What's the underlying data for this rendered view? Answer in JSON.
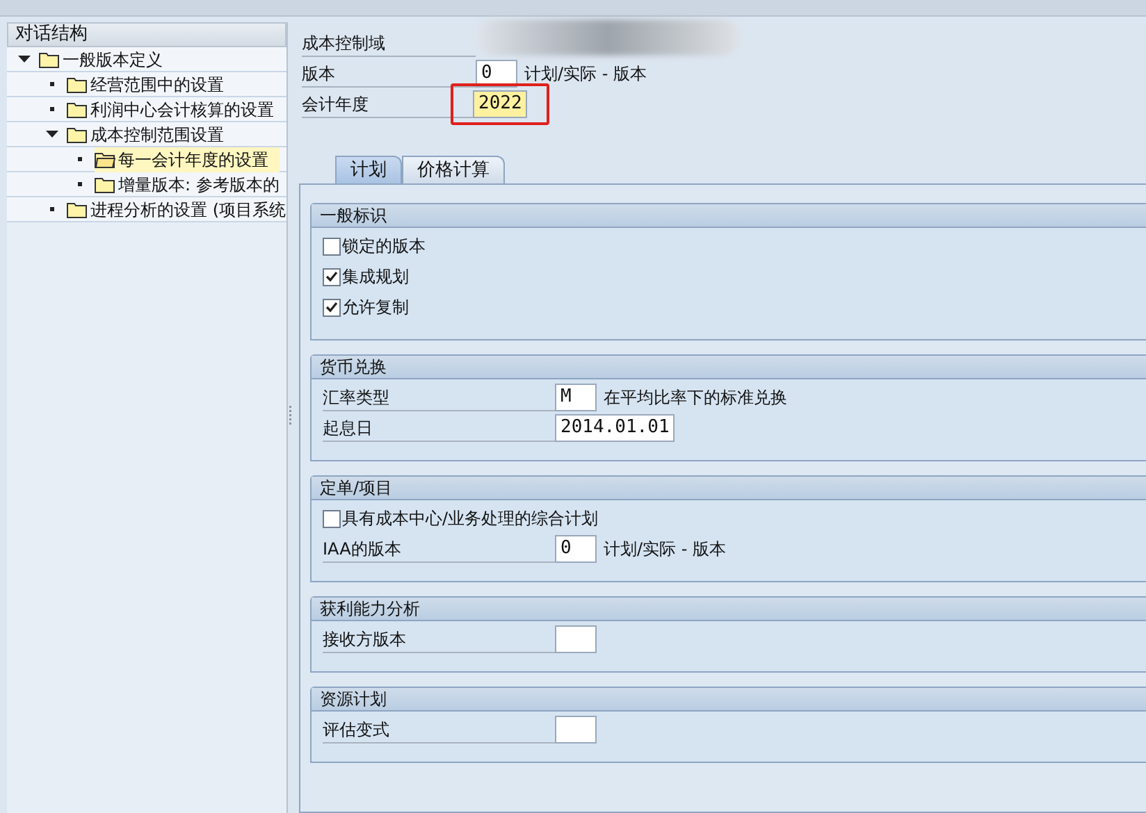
{
  "tree": {
    "title": "对话结构",
    "items": [
      {
        "kind": "branch",
        "label": "一般版本定义",
        "expanded": true,
        "selected": false,
        "children": [
          {
            "kind": "leaf",
            "label": "经营范围中的设置",
            "selected": false
          },
          {
            "kind": "leaf",
            "label": "利润中心会计核算的设置",
            "selected": false
          },
          {
            "kind": "branch",
            "label": "成本控制范围设置",
            "expanded": true,
            "selected": false,
            "children": [
              {
                "kind": "leaf",
                "label": "每一会计年度的设置",
                "selected": true
              },
              {
                "kind": "leaf",
                "label": "增量版本: 参考版本的",
                "selected": false
              }
            ]
          },
          {
            "kind": "leaf",
            "label": "进程分析的设置 (项目系统",
            "selected": false
          }
        ]
      }
    ]
  },
  "header": [
    {
      "kind": "masked",
      "label": "成本控制域"
    },
    {
      "kind": "field",
      "label": "版本",
      "value": "0",
      "note": "计划/实际 - 版本",
      "focused": false,
      "annotated": false
    },
    {
      "kind": "field",
      "label": "会计年度",
      "value": "2022",
      "focused": true,
      "annotated": true
    }
  ],
  "tabs": [
    {
      "label": "计划",
      "selected": true
    },
    {
      "label": "价格计算",
      "selected": false
    }
  ],
  "groups": [
    {
      "title": "一般标识",
      "rows": [
        {
          "kind": "checkbox",
          "label": "锁定的版本",
          "checked": false
        },
        {
          "kind": "checkbox",
          "label": "集成规划",
          "checked": true
        },
        {
          "kind": "checkbox",
          "label": "允许复制",
          "checked": true
        }
      ]
    },
    {
      "title": "货币兑换",
      "rows": [
        {
          "kind": "field",
          "label": "汇率类型",
          "value": "M",
          "note": "在平均比率下的标准兑换"
        },
        {
          "kind": "field",
          "label": "起息日",
          "value": "2014.01.01"
        }
      ]
    },
    {
      "title": "定单/项目",
      "rows": [
        {
          "kind": "checkbox",
          "label": "具有成本中心/业务处理的综合计划",
          "checked": false
        },
        {
          "kind": "field",
          "label": "IAA的版本",
          "value": "0",
          "note": "计划/实际 - 版本"
        }
      ]
    },
    {
      "title": "获利能力分析",
      "rows": [
        {
          "kind": "field",
          "label": "接收方版本"
        }
      ]
    },
    {
      "title": "资源计划",
      "rows": [
        {
          "kind": "field",
          "label": "评估变式"
        }
      ]
    }
  ]
}
